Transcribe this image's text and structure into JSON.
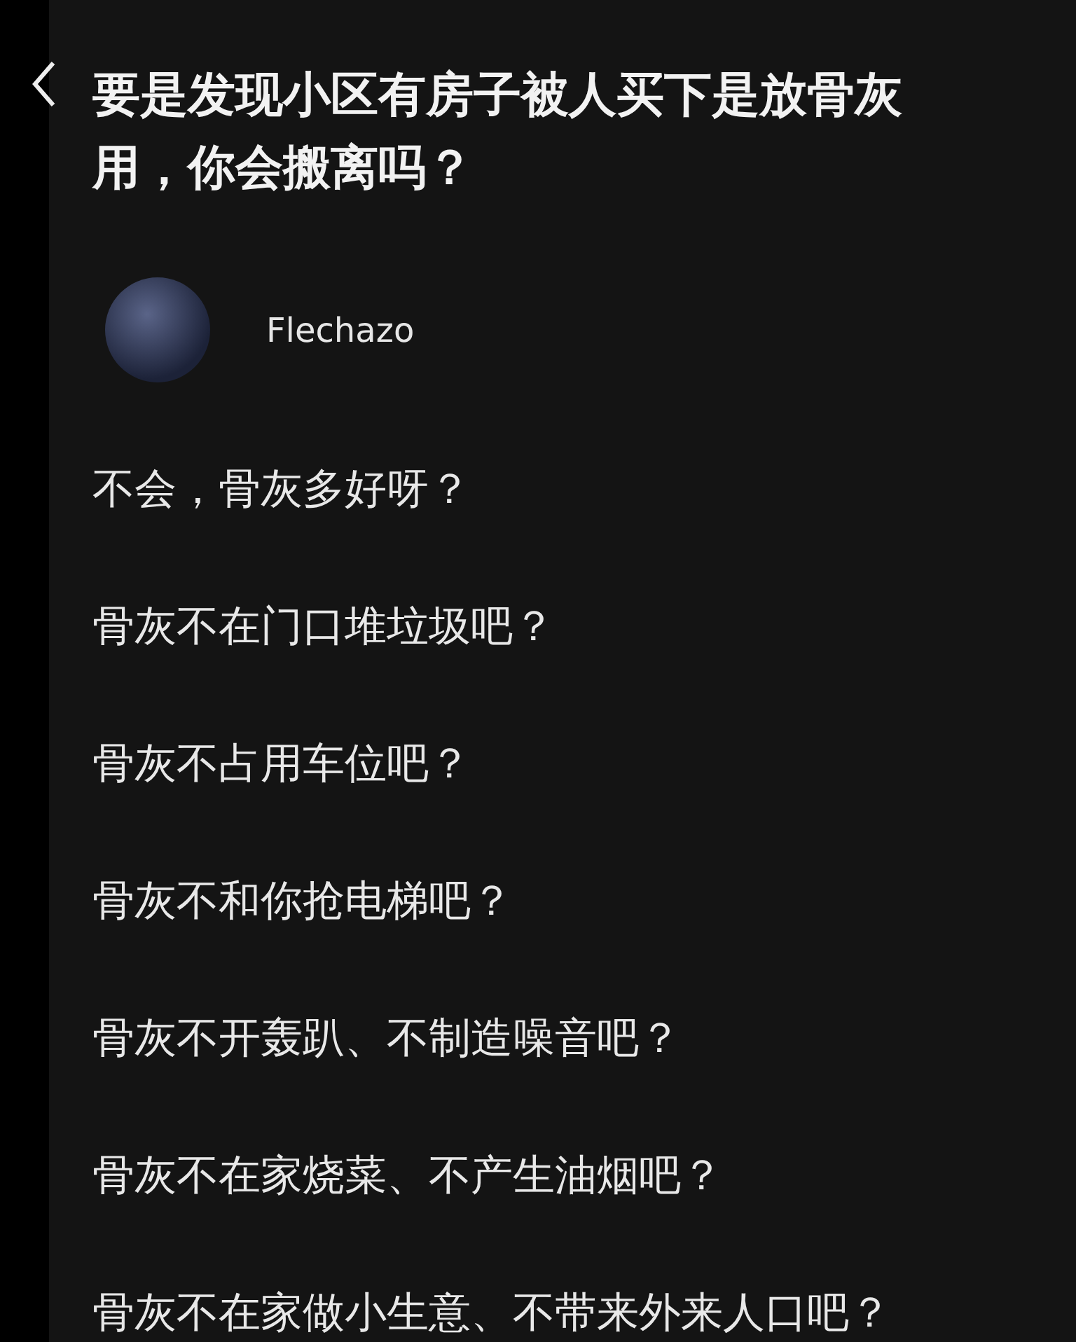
{
  "question": {
    "title": "要是发现小区有房子被人买下是放骨灰用，你会搬离吗？"
  },
  "answer": {
    "author": {
      "name": "Flechazo"
    },
    "paragraphs": [
      "不会，骨灰多好呀？",
      "骨灰不在门口堆垃圾吧？",
      "骨灰不占用车位吧？",
      "骨灰不和你抢电梯吧？",
      "骨灰不开轰趴、不制造噪音吧？",
      "骨灰不在家烧菜、不产生油烟吧？",
      "骨灰不在家做小生意、不带来外来人口吧？"
    ]
  }
}
